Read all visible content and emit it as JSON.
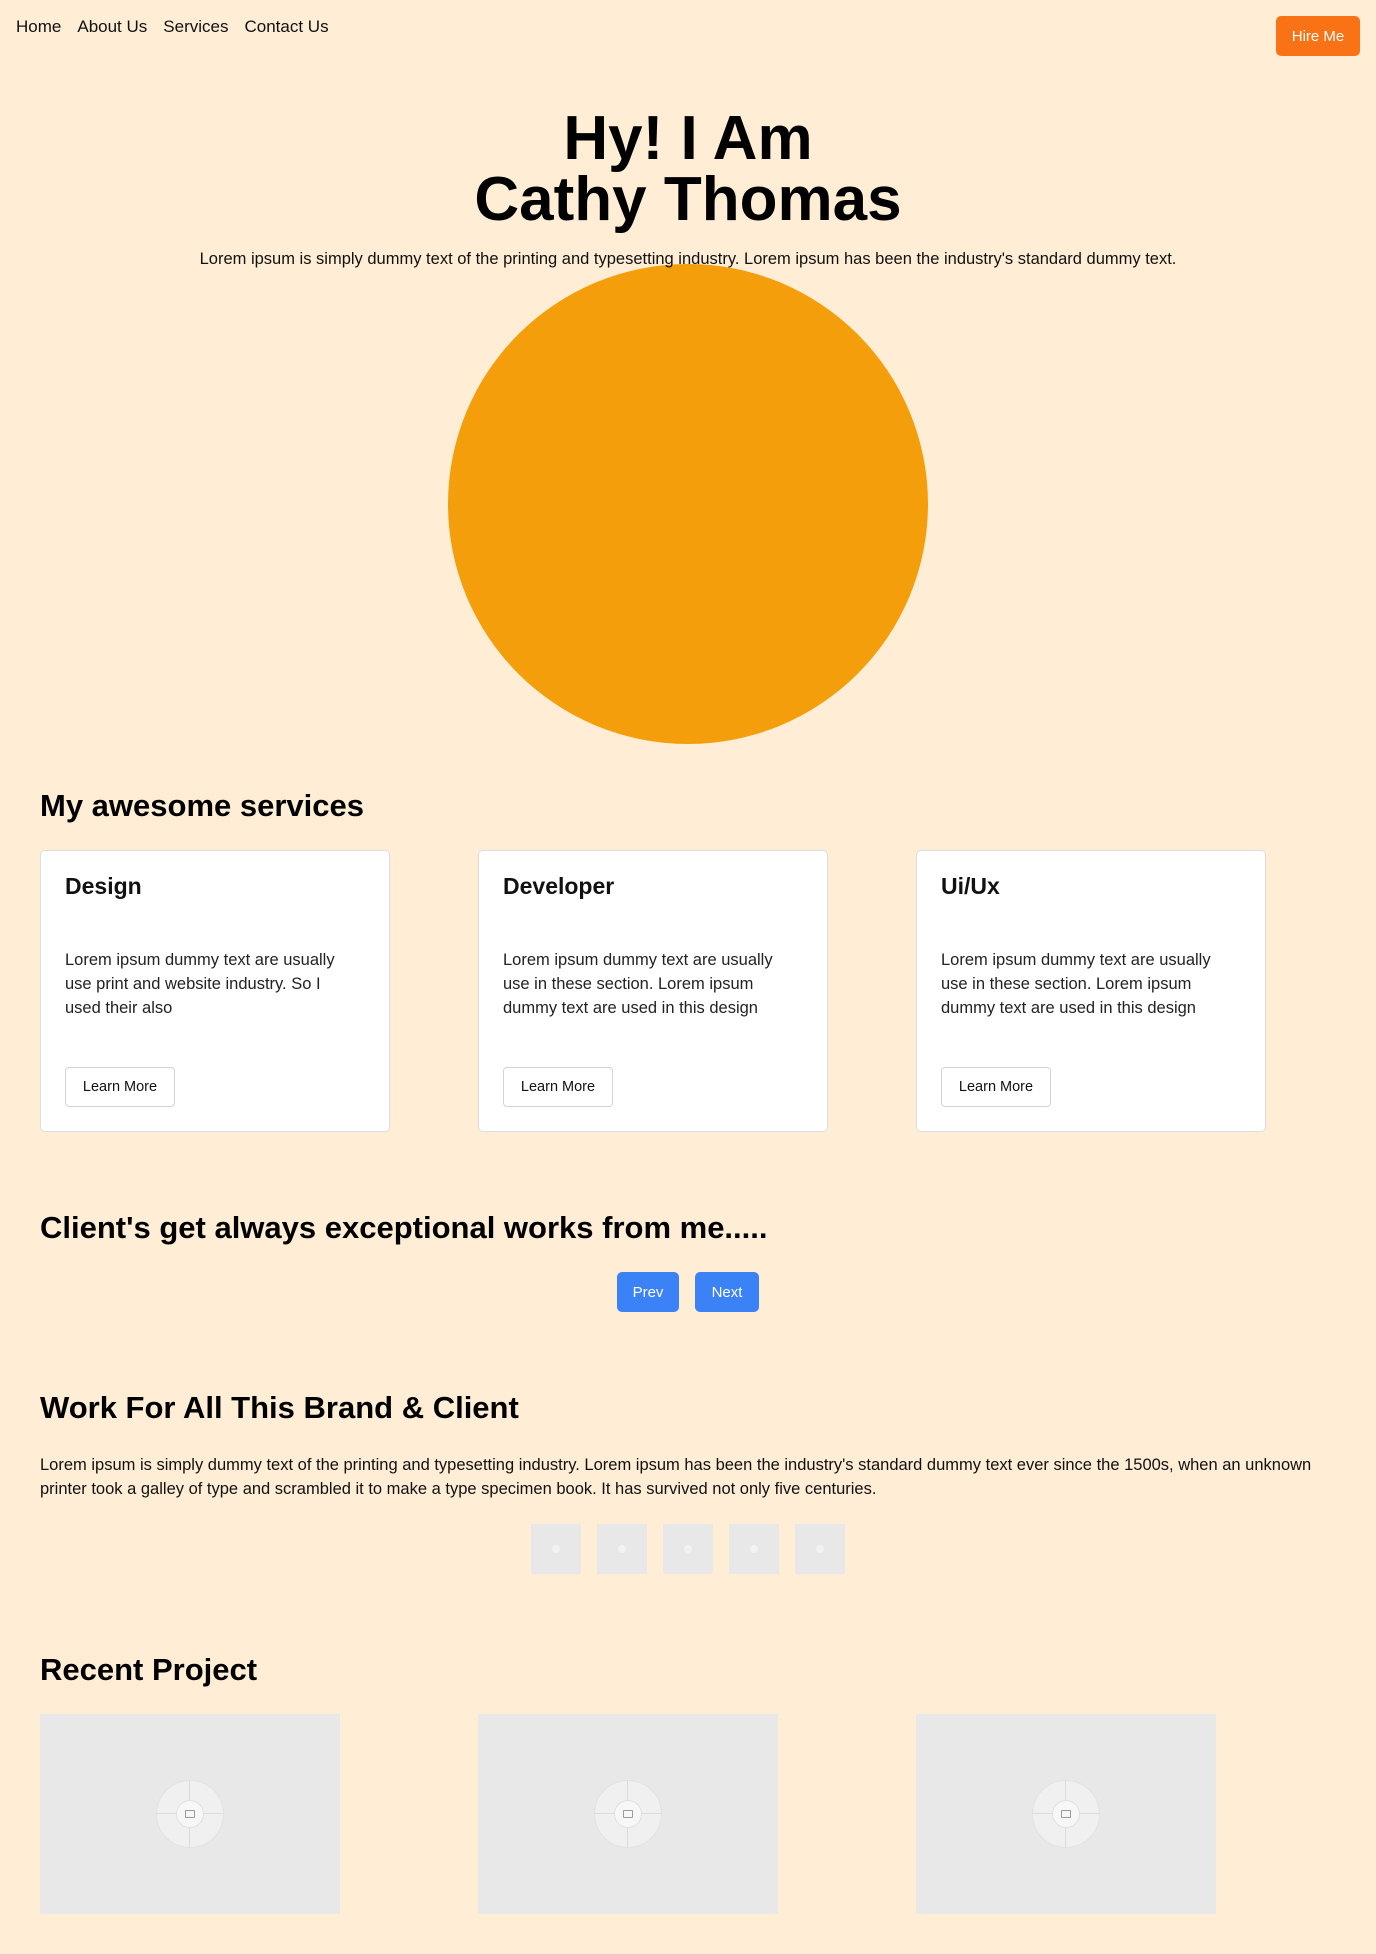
{
  "nav": {
    "links": [
      "Home",
      "About Us",
      "Services",
      "Contact Us"
    ],
    "hire_label": "Hire Me"
  },
  "hero": {
    "title_line1": "Hy! I Am",
    "title_line2": "Cathy Thomas",
    "subtitle": "Lorem ipsum is simply dummy text of the printing and typesetting industry. Lorem ipsum has been the industry's standard dummy text."
  },
  "services": {
    "heading": "My awesome services",
    "cards": [
      {
        "title": "Design",
        "text": "Lorem ipsum dummy text are usually use print and website industry. So I used their also",
        "button": "Learn More"
      },
      {
        "title": "Developer",
        "text": "Lorem ipsum dummy text are usually use in these section. Lorem ipsum dummy text are used in this design",
        "button": "Learn More"
      },
      {
        "title": "Ui/Ux",
        "text": "Lorem ipsum dummy text are usually use in these section. Lorem ipsum dummy text are used in this design",
        "button": "Learn More"
      }
    ]
  },
  "testimonials": {
    "heading": "Client's get always exceptional works from me.....",
    "prev_label": "Prev",
    "next_label": "Next"
  },
  "brands": {
    "heading": "Work For All This Brand & Client",
    "text": "Lorem ipsum is simply dummy text of the printing and typesetting industry. Lorem ipsum has been the industry's standard dummy text ever since the 1500s, when an unknown printer took a galley of type and scrambled it to make a type specimen book. It has survived not only five centuries."
  },
  "projects": {
    "heading": "Recent Project"
  },
  "colors": {
    "background": "#ffedd5",
    "hire_button": "#f97316",
    "hero_circle": "#f59e0b",
    "pager_button": "#3b82f6"
  }
}
